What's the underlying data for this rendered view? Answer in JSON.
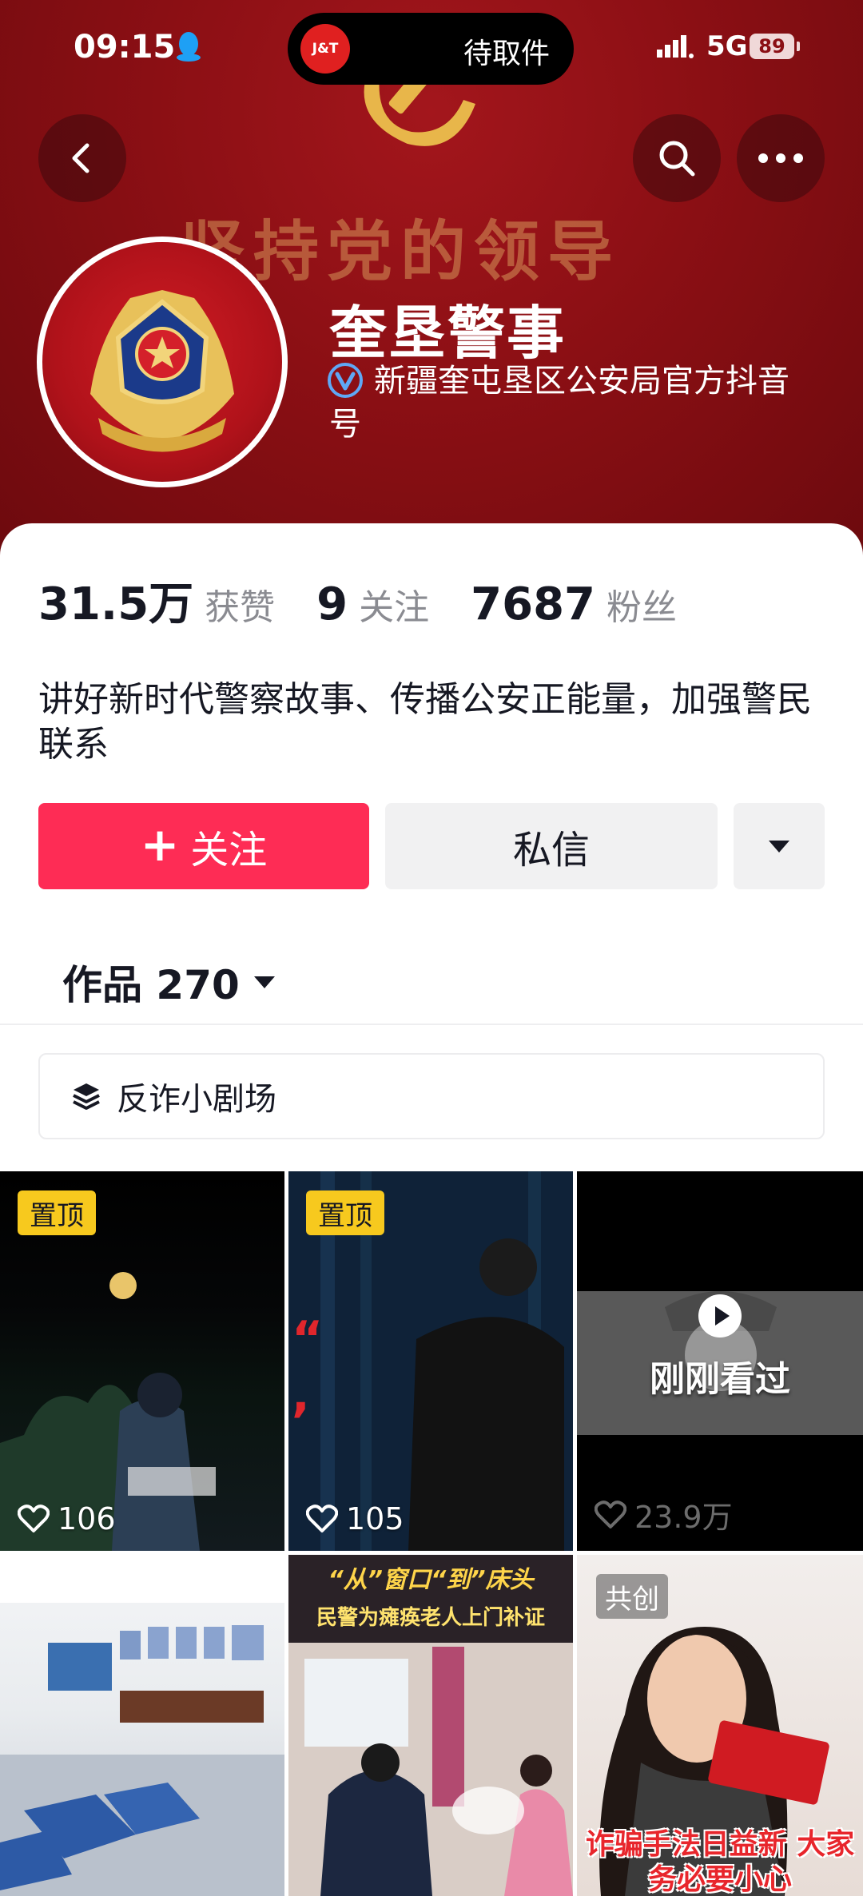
{
  "status_bar": {
    "time": "09:15",
    "island_logo": "J&T",
    "island_text": "待取件",
    "network": "5G",
    "battery": "89"
  },
  "banner": {
    "slogan": "坚持党的领导"
  },
  "profile": {
    "name": "奎垦警事",
    "verified_text": "新疆奎屯垦区公安局官方抖音号",
    "stats": {
      "likes_num": "31.5万",
      "likes_label": "获赞",
      "following_num": "9",
      "following_label": "关注",
      "followers_num": "7687",
      "followers_label": "粉丝"
    },
    "bio": "讲好新时代警察故事、传播公安正能量，加强警民联系"
  },
  "actions": {
    "follow_label": "关注",
    "message_label": "私信"
  },
  "tabs": {
    "works_label": "作品 270"
  },
  "collection": {
    "label": "反诈小剧场"
  },
  "videos": [
    {
      "badge": "置顶",
      "likes": "106"
    },
    {
      "badge": "置顶",
      "likes": "105"
    },
    {
      "overlay": "刚刚看过",
      "likes": "23.9万"
    },
    {},
    {
      "title": "“从”窗口“到”床头",
      "subtitle": "民警为瘫痪老人上门补证"
    },
    {
      "badge": "共创",
      "caption": "诈骗手法日益新 大家务必要小心"
    }
  ],
  "colors": {
    "accent": "#fe2c55",
    "banner": "#8b0f14",
    "pin_badge": "#f7c91e"
  }
}
